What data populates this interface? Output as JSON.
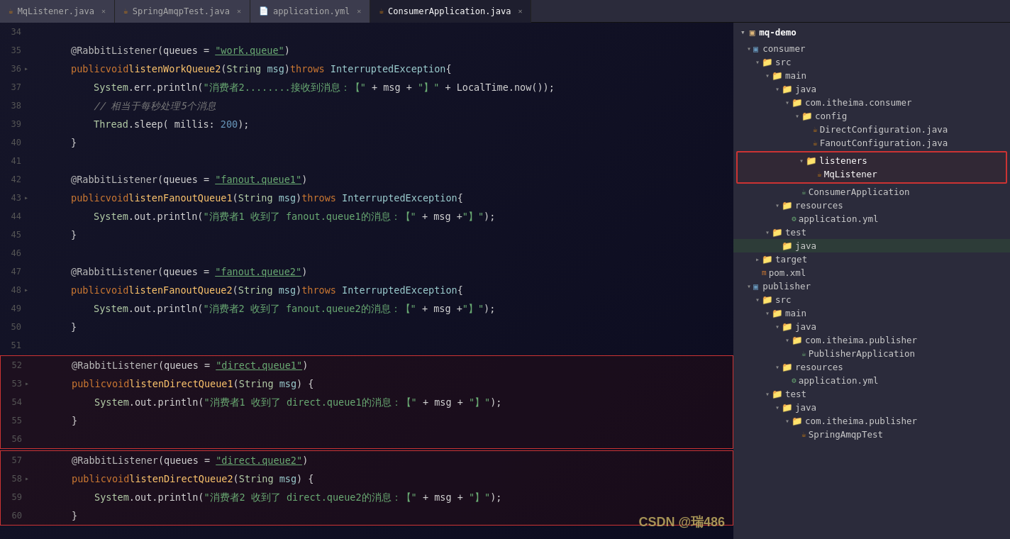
{
  "tabs": [
    {
      "label": "MqListener.java",
      "type": "java",
      "active": false
    },
    {
      "label": "SpringAmqpTest.java",
      "type": "java",
      "active": false
    },
    {
      "label": "application.yml",
      "type": "yaml",
      "active": false
    },
    {
      "label": "ConsumerApplication.java",
      "type": "java",
      "active": true
    }
  ],
  "code_lines": [
    {
      "num": "34",
      "indent": 0,
      "content": ""
    },
    {
      "num": "35",
      "indent": 4,
      "content_html": "<span class='annotation'>@RabbitListener</span><span class='plain'>(queues = </span><span class='str-underline'>\"work.queue\"</span><span class='plain'>)</span>"
    },
    {
      "num": "36",
      "indent": 4,
      "content_html": "<span class='kw'>public</span> <span class='kw'>void</span> <span class='method'>listenWorkQueue2</span><span class='plain'>(</span><span class='type'>String</span> <span class='param'>msg</span><span class='plain'>)</span> <span class='throws-kw'>throws</span> <span class='exc'>InterruptedException</span> <span class='plain'>{</span>"
    },
    {
      "num": "37",
      "indent": 8,
      "content_html": "<span class='type'>System</span><span class='plain'>.err.println(</span><span class='str'>\"消费者2........接收到消息：【\"</span> <span class='plain'>+ msg + </span><span class='str'>\"】\"</span> <span class='plain'>+ LocalTime.now());</span>"
    },
    {
      "num": "38",
      "indent": 8,
      "content_html": "<span class='comment'>// 相当于每秒处理5个消息</span>"
    },
    {
      "num": "39",
      "indent": 8,
      "content_html": "<span class='type'>Thread</span><span class='plain'>.sleep( millis: </span><span class='num'>200</span><span class='plain'>);</span>"
    },
    {
      "num": "40",
      "indent": 4,
      "content_html": "<span class='plain'>}</span>"
    },
    {
      "num": "41",
      "indent": 0,
      "content": ""
    },
    {
      "num": "42",
      "indent": 4,
      "content_html": "<span class='annotation'>@RabbitListener</span><span class='plain'>(queues = </span><span class='str-underline'>\"fanout.queue1\"</span><span class='plain'>)</span>"
    },
    {
      "num": "43",
      "indent": 4,
      "content_html": "<span class='kw'>public</span> <span class='kw'>void</span> <span class='method'>listenFanoutQueue1</span><span class='plain'>(</span><span class='type'>String</span> <span class='param'>msg</span><span class='plain'>)</span> <span class='throws-kw'>throws</span> <span class='exc'>InterruptedException</span> <span class='plain'>{</span>"
    },
    {
      "num": "44",
      "indent": 8,
      "content_html": "<span class='type'>System</span><span class='plain'>.out.println(</span><span class='str'>\"消费者1 收到了 fanout.queue1的消息：【\"</span> <span class='plain'>+ msg +</span><span class='str'>\"】\"</span><span class='plain'>);</span>"
    },
    {
      "num": "45",
      "indent": 4,
      "content_html": "<span class='plain'>}</span>"
    },
    {
      "num": "46",
      "indent": 0,
      "content": ""
    },
    {
      "num": "47",
      "indent": 4,
      "content_html": "<span class='annotation'>@RabbitListener</span><span class='plain'>(queues = </span><span class='str-underline'>\"fanout.queue2\"</span><span class='plain'>)</span>"
    },
    {
      "num": "48",
      "indent": 4,
      "content_html": "<span class='kw'>public</span> <span class='kw'>void</span> <span class='method'>listenFanoutQueue2</span><span class='plain'>(</span><span class='type'>String</span> <span class='param'>msg</span><span class='plain'>)</span> <span class='throws-kw'>throws</span> <span class='exc'>InterruptedException</span> <span class='plain'>{</span>"
    },
    {
      "num": "49",
      "indent": 8,
      "content_html": "<span class='type'>System</span><span class='plain'>.out.println(</span><span class='str'>\"消费者2 收到了 fanout.queue2的消息：【\"</span> <span class='plain'>+ msg +</span><span class='str'>\"】\"</span><span class='plain'>);</span>"
    },
    {
      "num": "50",
      "indent": 4,
      "content_html": "<span class='plain'>}</span>"
    },
    {
      "num": "51",
      "indent": 0,
      "content": ""
    },
    {
      "num": "52",
      "indent": 4,
      "content_html": "<span class='annotation'>@RabbitListener</span><span class='plain'>(queues = </span><span class='str-underline'>\"direct.queue1\"</span><span class='plain'>)</span>",
      "hl_upper": true
    },
    {
      "num": "53",
      "indent": 4,
      "content_html": "<span class='kw'>public</span> <span class='kw'>void</span> <span class='method'>listenDirectQueue1</span><span class='plain'>(</span><span class='type'>String</span> <span class='param'>msg</span><span class='plain'>) {</span>",
      "hl_upper": true
    },
    {
      "num": "54",
      "indent": 8,
      "content_html": "<span class='type'>System</span><span class='plain'>.out.println(</span><span class='str'>\"消费者1 收到了 direct.queue1的消息：【\"</span> <span class='plain'>+ msg + </span><span class='str'>\"】\"</span><span class='plain'>);</span>",
      "hl_upper": true
    },
    {
      "num": "55",
      "indent": 4,
      "content_html": "<span class='plain'>}</span>",
      "hl_upper": true
    },
    {
      "num": "56",
      "indent": 0,
      "content": "",
      "hl_upper": true
    },
    {
      "num": "57",
      "indent": 4,
      "content_html": "<span class='annotation'>@RabbitListener</span><span class='plain'>(queues = </span><span class='str-underline'>\"direct.queue2\"</span><span class='plain'>)</span>",
      "hl_lower": true
    },
    {
      "num": "58",
      "indent": 4,
      "content_html": "<span class='kw'>public</span> <span class='kw'>void</span> <span class='method'>listenDirectQueue2</span><span class='plain'>(</span><span class='type'>String</span> <span class='param'>msg</span><span class='plain'>) {</span>",
      "hl_lower": true
    },
    {
      "num": "59",
      "indent": 8,
      "content_html": "<span class='type'>System</span><span class='plain'>.out.println(</span><span class='str'>\"消费者2 收到了 direct.queue2的消息：【\"</span> <span class='plain'>+ msg + </span><span class='str'>\"】\"</span><span class='plain'>);</span>",
      "hl_lower": true
    },
    {
      "num": "60",
      "indent": 4,
      "content_html": "<span class='plain'>}</span>",
      "hl_lower": true
    }
  ],
  "project_tree": {
    "root": "mq-demo",
    "items": [
      {
        "level": 1,
        "label": "consumer",
        "type": "module",
        "expanded": true
      },
      {
        "level": 2,
        "label": "src",
        "type": "folder",
        "expanded": true
      },
      {
        "level": 3,
        "label": "main",
        "type": "folder",
        "expanded": true
      },
      {
        "level": 4,
        "label": "java",
        "type": "folder",
        "expanded": true
      },
      {
        "level": 5,
        "label": "com.itheima.consumer",
        "type": "folder",
        "expanded": true
      },
      {
        "level": 6,
        "label": "config",
        "type": "folder",
        "expanded": true
      },
      {
        "level": 7,
        "label": "DirectConfiguration.java",
        "type": "java"
      },
      {
        "level": 7,
        "label": "FanoutConfiguration.java",
        "type": "java"
      },
      {
        "level": 6,
        "label": "listeners",
        "type": "folder",
        "expanded": true,
        "highlighted": true
      },
      {
        "level": 7,
        "label": "MqListener",
        "type": "java",
        "highlighted": true
      },
      {
        "level": 5,
        "label": "ConsumerApplication",
        "type": "java"
      },
      {
        "level": 4,
        "label": "resources",
        "type": "folder",
        "expanded": true
      },
      {
        "level": 5,
        "label": "application.yml",
        "type": "yaml"
      },
      {
        "level": 3,
        "label": "test",
        "type": "folder",
        "expanded": false
      },
      {
        "level": 4,
        "label": "java",
        "type": "folder",
        "green": true
      },
      {
        "level": 2,
        "label": "target",
        "type": "folder",
        "expanded": false
      },
      {
        "level": 2,
        "label": "pom.xml",
        "type": "xml"
      },
      {
        "level": 1,
        "label": "publisher",
        "type": "module",
        "expanded": true
      },
      {
        "level": 2,
        "label": "src",
        "type": "folder",
        "expanded": true
      },
      {
        "level": 3,
        "label": "main",
        "type": "folder",
        "expanded": true
      },
      {
        "level": 4,
        "label": "java",
        "type": "folder",
        "expanded": true
      },
      {
        "level": 5,
        "label": "com.itheima.publisher",
        "type": "folder",
        "expanded": true
      },
      {
        "level": 6,
        "label": "PublisherApplication",
        "type": "java"
      },
      {
        "level": 4,
        "label": "resources",
        "type": "folder",
        "expanded": true
      },
      {
        "level": 5,
        "label": "application.yml",
        "type": "yaml"
      },
      {
        "level": 3,
        "label": "test",
        "type": "folder",
        "expanded": true
      },
      {
        "level": 4,
        "label": "java",
        "type": "folder",
        "expanded": true
      },
      {
        "level": 5,
        "label": "com.itheima.publisher",
        "type": "folder",
        "expanded": true
      },
      {
        "level": 6,
        "label": "SpringAmqpTest",
        "type": "java"
      }
    ]
  },
  "watermark": "CSDN @瑞486"
}
